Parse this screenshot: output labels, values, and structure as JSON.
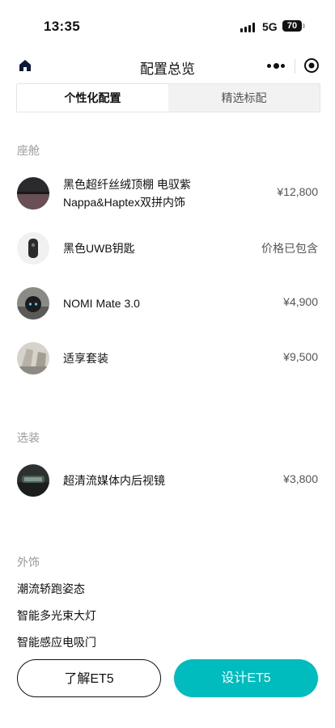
{
  "status_bar": {
    "time": "13:35",
    "network": "5G",
    "battery": "70"
  },
  "nav": {
    "title": "配置总览"
  },
  "tabs": [
    {
      "label": "个性化配置",
      "active": true
    },
    {
      "label": "精选标配",
      "active": false
    }
  ],
  "sections": {
    "cabin": {
      "label": "座舱",
      "items": [
        {
          "name_line1": "黑色超纤丝绒顶棚 电驭紫",
          "name_line2": "Nappa&Haptex双拼内饰",
          "price": "¥12,800"
        },
        {
          "name": "黑色UWB钥匙",
          "price": "价格已包含"
        },
        {
          "name": "NOMI Mate 3.0",
          "price": "¥4,900"
        },
        {
          "name": "适享套装",
          "price": "¥9,500"
        }
      ]
    },
    "options": {
      "label": "选装",
      "items": [
        {
          "name": "超清流媒体内后视镜",
          "price": "¥3,800"
        }
      ]
    },
    "exterior": {
      "label": "外饰",
      "items": [
        "潮流轿跑姿态",
        "智能多光束大灯",
        "智能感应电吸门"
      ]
    }
  },
  "buttons": {
    "learn": "了解ET5",
    "design": "设计ET5"
  },
  "colors": {
    "accent": "#00bcbe"
  }
}
